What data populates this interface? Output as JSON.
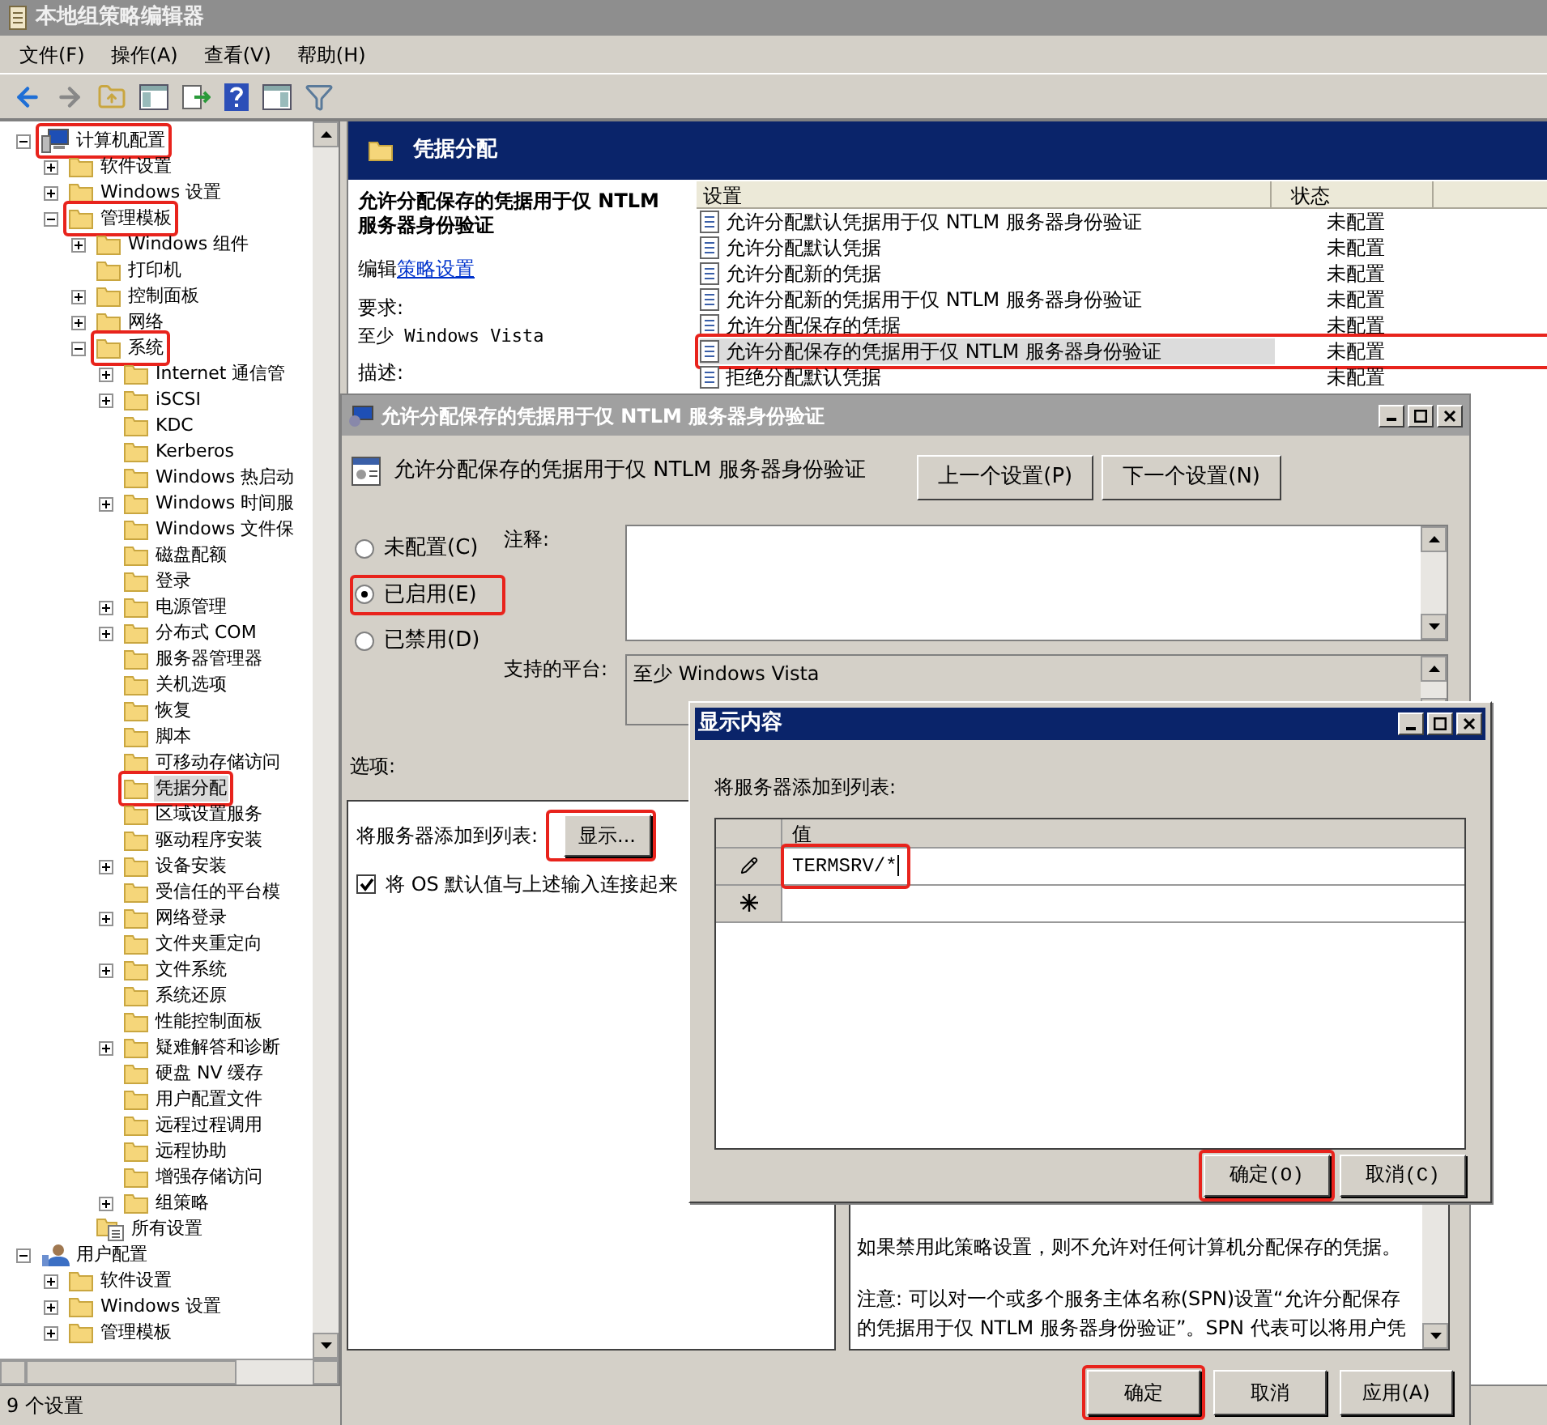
{
  "window": {
    "title": "本地组策略编辑器"
  },
  "menu": [
    "文件(F)",
    "操作(A)",
    "查看(V)",
    "帮助(H)"
  ],
  "tree": [
    {
      "label": "计算机配置",
      "kind": "computer",
      "expanded": true,
      "selected": false,
      "highlighted": true,
      "children": [
        {
          "label": "软件设置",
          "kind": "folder",
          "expanded": false,
          "selected": false,
          "highlighted": false
        },
        {
          "label": "Windows 设置",
          "kind": "folder",
          "expanded": false,
          "selected": false,
          "highlighted": false
        },
        {
          "label": "管理模板",
          "kind": "folder",
          "expanded": true,
          "selected": false,
          "highlighted": true,
          "children": [
            {
              "label": "Windows 组件",
              "kind": "folder",
              "expanded": false,
              "selected": false,
              "highlighted": false
            },
            {
              "label": "打印机",
              "kind": "folder",
              "selected": false,
              "highlighted": false
            },
            {
              "label": "控制面板",
              "kind": "folder",
              "expanded": false,
              "selected": false,
              "highlighted": false
            },
            {
              "label": "网络",
              "kind": "folder",
              "expanded": false,
              "selected": false,
              "highlighted": false
            },
            {
              "label": "系统",
              "kind": "folder",
              "expanded": true,
              "selected": false,
              "highlighted": true,
              "children": [
                {
                  "label": "Internet 通信管",
                  "kind": "folder",
                  "expanded": false,
                  "selected": false,
                  "highlighted": false
                },
                {
                  "label": "iSCSI",
                  "kind": "folder",
                  "expanded": false,
                  "selected": false,
                  "highlighted": false
                },
                {
                  "label": "KDC",
                  "kind": "folder",
                  "selected": false,
                  "highlighted": false
                },
                {
                  "label": "Kerberos",
                  "kind": "folder",
                  "selected": false,
                  "highlighted": false
                },
                {
                  "label": "Windows 热启动",
                  "kind": "folder",
                  "selected": false,
                  "highlighted": false
                },
                {
                  "label": "Windows 时间服",
                  "kind": "folder",
                  "expanded": false,
                  "selected": false,
                  "highlighted": false
                },
                {
                  "label": "Windows 文件保",
                  "kind": "folder",
                  "selected": false,
                  "highlighted": false
                },
                {
                  "label": "磁盘配额",
                  "kind": "folder",
                  "selected": false,
                  "highlighted": false
                },
                {
                  "label": "登录",
                  "kind": "folder",
                  "selected": false,
                  "highlighted": false
                },
                {
                  "label": "电源管理",
                  "kind": "folder",
                  "expanded": false,
                  "selected": false,
                  "highlighted": false
                },
                {
                  "label": "分布式 COM",
                  "kind": "folder",
                  "expanded": false,
                  "selected": false,
                  "highlighted": false
                },
                {
                  "label": "服务器管理器",
                  "kind": "folder",
                  "selected": false,
                  "highlighted": false
                },
                {
                  "label": "关机选项",
                  "kind": "folder",
                  "selected": false,
                  "highlighted": false
                },
                {
                  "label": "恢复",
                  "kind": "folder",
                  "selected": false,
                  "highlighted": false
                },
                {
                  "label": "脚本",
                  "kind": "folder",
                  "selected": false,
                  "highlighted": false
                },
                {
                  "label": "可移动存储访问",
                  "kind": "folder",
                  "selected": false,
                  "highlighted": false
                },
                {
                  "label": "凭据分配",
                  "kind": "folder",
                  "selected": true,
                  "highlighted": true
                },
                {
                  "label": "区域设置服务",
                  "kind": "folder",
                  "selected": false,
                  "highlighted": false
                },
                {
                  "label": "驱动程序安装",
                  "kind": "folder",
                  "selected": false,
                  "highlighted": false
                },
                {
                  "label": "设备安装",
                  "kind": "folder",
                  "expanded": false,
                  "selected": false,
                  "highlighted": false
                },
                {
                  "label": "受信任的平台模",
                  "kind": "folder",
                  "selected": false,
                  "highlighted": false
                },
                {
                  "label": "网络登录",
                  "kind": "folder",
                  "expanded": false,
                  "selected": false,
                  "highlighted": false
                },
                {
                  "label": "文件夹重定向",
                  "kind": "folder",
                  "selected": false,
                  "highlighted": false
                },
                {
                  "label": "文件系统",
                  "kind": "folder",
                  "expanded": false,
                  "selected": false,
                  "highlighted": false
                },
                {
                  "label": "系统还原",
                  "kind": "folder",
                  "selected": false,
                  "highlighted": false
                },
                {
                  "label": "性能控制面板",
                  "kind": "folder",
                  "selected": false,
                  "highlighted": false
                },
                {
                  "label": "疑难解答和诊断",
                  "kind": "folder",
                  "expanded": false,
                  "selected": false,
                  "highlighted": false
                },
                {
                  "label": "硬盘 NV 缓存",
                  "kind": "folder",
                  "selected": false,
                  "highlighted": false
                },
                {
                  "label": "用户配置文件",
                  "kind": "folder",
                  "selected": false,
                  "highlighted": false
                },
                {
                  "label": "远程过程调用",
                  "kind": "folder",
                  "selected": false,
                  "highlighted": false
                },
                {
                  "label": "远程协助",
                  "kind": "folder",
                  "selected": false,
                  "highlighted": false
                },
                {
                  "label": "增强存储访问",
                  "kind": "folder",
                  "selected": false,
                  "highlighted": false
                },
                {
                  "label": "组策略",
                  "kind": "folder",
                  "expanded": false,
                  "selected": false,
                  "highlighted": false
                }
              ]
            },
            {
              "label": "所有设置",
              "kind": "settings-list",
              "selected": false,
              "highlighted": false
            }
          ]
        }
      ]
    },
    {
      "label": "用户配置",
      "kind": "user",
      "expanded": true,
      "selected": false,
      "highlighted": false,
      "children": [
        {
          "label": "软件设置",
          "kind": "folder",
          "expanded": false,
          "selected": false,
          "highlighted": false
        },
        {
          "label": "Windows 设置",
          "kind": "folder",
          "expanded": false,
          "selected": false,
          "highlighted": false
        },
        {
          "label": "管理模板",
          "kind": "folder",
          "expanded": false,
          "selected": false,
          "highlighted": false
        }
      ]
    }
  ],
  "status_bar": "9 个设置",
  "right_pane": {
    "header": "凭据分配",
    "description": {
      "title": "允许分配保存的凭据用于仅 NTLM 服务器身份验证",
      "edit_prefix": "编辑",
      "edit_link": "策略设置",
      "requirement_label": "要求:",
      "requirement": "至少 Windows Vista",
      "description_label": "描述:"
    },
    "list": {
      "columns": [
        "设置",
        "状态"
      ],
      "rows": [
        {
          "name": "允许分配默认凭据用于仅 NTLM 服务器身份验证",
          "status": "未配置",
          "selected": false,
          "highlighted": false
        },
        {
          "name": "允许分配默认凭据",
          "status": "未配置",
          "selected": false,
          "highlighted": false
        },
        {
          "name": "允许分配新的凭据",
          "status": "未配置",
          "selected": false,
          "highlighted": false
        },
        {
          "name": "允许分配新的凭据用于仅 NTLM 服务器身份验证",
          "status": "未配置",
          "selected": false,
          "highlighted": false
        },
        {
          "name": "允许分配保存的凭据",
          "status": "未配置",
          "selected": false,
          "highlighted": false
        },
        {
          "name": "允许分配保存的凭据用于仅 NTLM 服务器身份验证",
          "status": "未配置",
          "selected": true,
          "highlighted": true
        },
        {
          "name": "拒绝分配默认凭据",
          "status": "未配置",
          "selected": false,
          "highlighted": false
        }
      ]
    }
  },
  "policy_dialog": {
    "title": "允许分配保存的凭据用于仅 NTLM 服务器身份验证",
    "heading": "允许分配保存的凭据用于仅 NTLM 服务器身份验证",
    "nav_buttons": [
      "上一个设置(P)",
      "下一个设置(N)"
    ],
    "states": [
      {
        "label": "未配置(C)",
        "selected": false,
        "highlighted": false
      },
      {
        "label": "已启用(E)",
        "selected": true,
        "highlighted": true
      },
      {
        "label": "已禁用(D)",
        "selected": false,
        "highlighted": false
      }
    ],
    "comment_label": "注释:",
    "platform_label": "支持的平台:",
    "platform": "至少 Windows Vista",
    "options_label": "选项:",
    "options": {
      "list_label": "将服务器添加到列表:",
      "show_button": {
        "label": "显示...",
        "highlighted": true
      },
      "concat": {
        "label": "将 OS 默认值与上述输入连接起来",
        "checked": true
      }
    },
    "help": [
      "如果禁用此策略设置，则不允许对任何计算机分配保存的凭据。",
      "注意: 可以对一个或多个服务主体名称(SPN)设置“允许分配保存的凭据用于仅 NTLM 服务器身份验证”。SPN 代表可以将用户凭"
    ],
    "buttons": [
      {
        "label": "确定",
        "highlighted": true
      },
      {
        "label": "取消",
        "highlighted": false
      },
      {
        "label": "应用(A)",
        "highlighted": false
      }
    ]
  },
  "show_dialog": {
    "title": "显示内容",
    "label": "将服务器添加到列表:",
    "column": "值",
    "rows": [
      {
        "value": "TERMSRV/*",
        "editing": true,
        "highlighted": true
      }
    ],
    "buttons": [
      {
        "label": "确定(O)",
        "highlighted": true
      },
      {
        "label": "取消(C)",
        "highlighted": false
      }
    ]
  }
}
